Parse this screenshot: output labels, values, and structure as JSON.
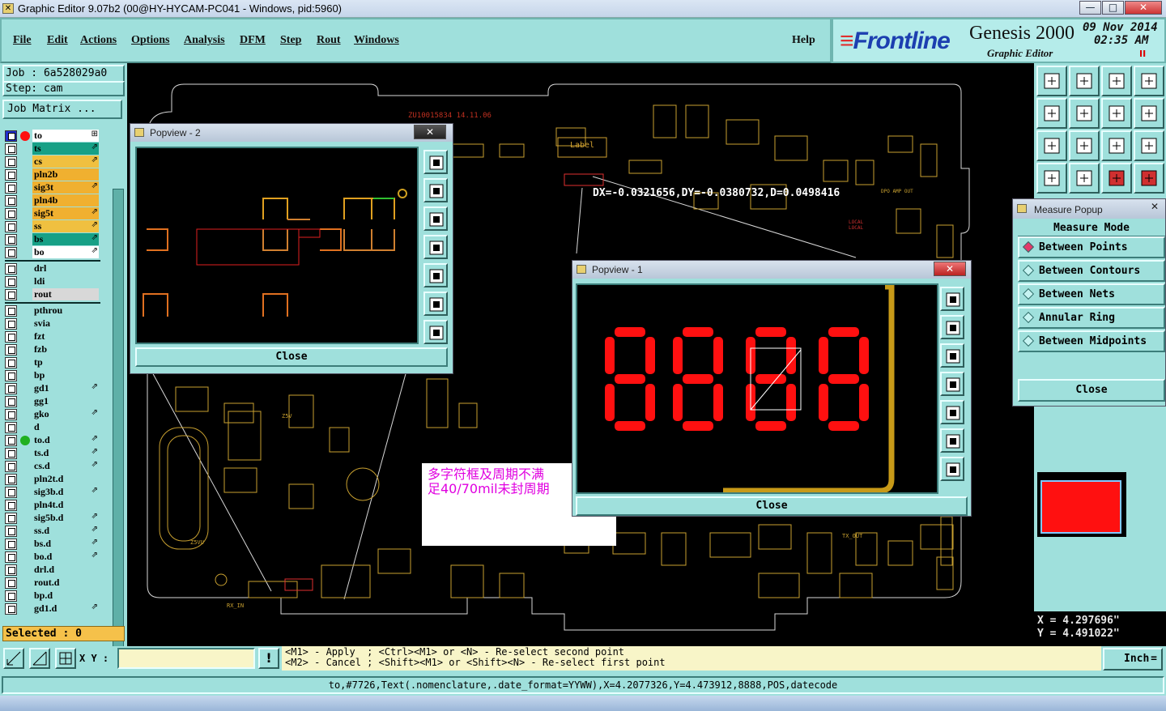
{
  "window": {
    "title": "Graphic Editor 9.07b2 (00@HY-HYCAM-PC041 - Windows, pid:5960)",
    "min": "—",
    "max": "□",
    "close": "✕"
  },
  "menu": {
    "items": [
      "File",
      "Edit",
      "Actions",
      "Options",
      "Analysis",
      "DFM",
      "Step",
      "Rout",
      "Windows"
    ],
    "help": "Help"
  },
  "brand": {
    "logo": "Frontline",
    "product": "Genesis 2000",
    "subtitle": "Graphic Editor",
    "date": "09 Nov 2014",
    "time": "02:35 AM",
    "pause": "II"
  },
  "job": {
    "job_label": "Job : 6a528029a0",
    "step_label": "Step: cam",
    "matrix_button": "Job Matrix ..."
  },
  "layers": [
    {
      "name": "to",
      "color": "#ffffff",
      "mark": "⊞"
    },
    {
      "name": "ts",
      "color": "#17a086",
      "mark": "⇗"
    },
    {
      "name": "cs",
      "color": "#f0c040",
      "mark": "⇗"
    },
    {
      "name": "pln2b",
      "color": "#f0b030",
      "mark": ""
    },
    {
      "name": "sig3t",
      "color": "#f0b030",
      "mark": "⇗"
    },
    {
      "name": "pln4b",
      "color": "#f0b030",
      "mark": ""
    },
    {
      "name": "sig5t",
      "color": "#f0b030",
      "mark": "⇗"
    },
    {
      "name": "ss",
      "color": "#f0c040",
      "mark": "⇗"
    },
    {
      "name": "bs",
      "color": "#17a086",
      "mark": "⇗"
    },
    {
      "name": "bo",
      "color": "#ffffff",
      "mark": "⇗"
    },
    {
      "name": "drl",
      "color": "#9fe0dc",
      "mark": ""
    },
    {
      "name": "ldi",
      "color": "#9fe0dc",
      "mark": ""
    },
    {
      "name": "rout",
      "color": "#d8d8d8",
      "mark": ""
    },
    {
      "name": "pthrou",
      "color": "#9fe0dc",
      "mark": ""
    },
    {
      "name": "svia",
      "color": "#9fe0dc",
      "mark": ""
    },
    {
      "name": "fzt",
      "color": "#9fe0dc",
      "mark": ""
    },
    {
      "name": "fzb",
      "color": "#9fe0dc",
      "mark": ""
    },
    {
      "name": "tp",
      "color": "#9fe0dc",
      "mark": ""
    },
    {
      "name": "bp",
      "color": "#9fe0dc",
      "mark": ""
    },
    {
      "name": "gd1",
      "color": "#9fe0dc",
      "mark": "⇗"
    },
    {
      "name": "gg1",
      "color": "#9fe0dc",
      "mark": ""
    },
    {
      "name": "gko",
      "color": "#9fe0dc",
      "mark": "⇗"
    },
    {
      "name": "d",
      "color": "#9fe0dc",
      "mark": ""
    },
    {
      "name": "to.d",
      "color": "#9fe0dc",
      "mark": "⇗"
    },
    {
      "name": "ts.d",
      "color": "#9fe0dc",
      "mark": "⇗"
    },
    {
      "name": "cs.d",
      "color": "#9fe0dc",
      "mark": "⇗"
    },
    {
      "name": "pln2t.d",
      "color": "#9fe0dc",
      "mark": ""
    },
    {
      "name": "sig3b.d",
      "color": "#9fe0dc",
      "mark": "⇗"
    },
    {
      "name": "pln4t.d",
      "color": "#9fe0dc",
      "mark": ""
    },
    {
      "name": "sig5b.d",
      "color": "#9fe0dc",
      "mark": "⇗"
    },
    {
      "name": "ss.d",
      "color": "#9fe0dc",
      "mark": "⇗"
    },
    {
      "name": "bs.d",
      "color": "#9fe0dc",
      "mark": "⇗"
    },
    {
      "name": "bo.d",
      "color": "#9fe0dc",
      "mark": "⇗"
    },
    {
      "name": "drl.d",
      "color": "#9fe0dc",
      "mark": ""
    },
    {
      "name": "rout.d",
      "color": "#9fe0dc",
      "mark": ""
    },
    {
      "name": "bp.d",
      "color": "#9fe0dc",
      "mark": ""
    },
    {
      "name": "gd1.d",
      "color": "#9fe0dc",
      "mark": "⇗"
    }
  ],
  "selected": "Selected : 0",
  "canvas": {
    "part_label": "ZU10015834 14.11.06",
    "label_box": "Label",
    "measure_readout": "DX=-0.0321656,DY=-0.0380732,D=0.0498416",
    "silk": {
      "dpo": "DPO AMP OUT",
      "local": "LOCAL",
      "local2": "LOCAL",
      "z5v": "Z5V",
      "z5vu": "Z5VU",
      "rxin": "RX_IN",
      "txout": "TX_OUT"
    },
    "note_line1": "多字符框及周期不满",
    "note_line2": "足40/70mil未封周期"
  },
  "popview2": {
    "title": "Popview - 2",
    "close_x": "✕",
    "close_label": "Close"
  },
  "popview1": {
    "title": "Popview - 1",
    "close_x": "✕",
    "close_label": "Close",
    "digits": "8888"
  },
  "measure": {
    "title": "Measure Popup",
    "close_x": "✕",
    "mode_label": "Measure Mode",
    "options": [
      "Between Points",
      "Between Contours",
      "Between Nets",
      "Annular Ring",
      "Between Midpoints"
    ],
    "selected_index": 0,
    "close_label": "Close"
  },
  "coords": {
    "x": "X = 4.297696\"",
    "y": "Y = 4.491022\""
  },
  "bottom": {
    "xy_label": "X Y :",
    "xy_value": "",
    "alert": "!",
    "prompt_line1": "<M1> - Apply  ; <Ctrl><M1> or <N> - Re-select second point",
    "prompt_line2": "<M2> - Cancel ; <Shift><M1> or <Shift><N> - Re-select first point",
    "unit": "Inch",
    "status": "to,#7726,Text(.nomenclature,.date_format=YYWW),X=4.2077326,Y=4.473912,8888,POS,datecode"
  },
  "colors": {
    "panel": "#9fe0dc",
    "pcb_trace": "#c8a030",
    "digit": "#ff1010",
    "note_text": "#e000e0"
  }
}
